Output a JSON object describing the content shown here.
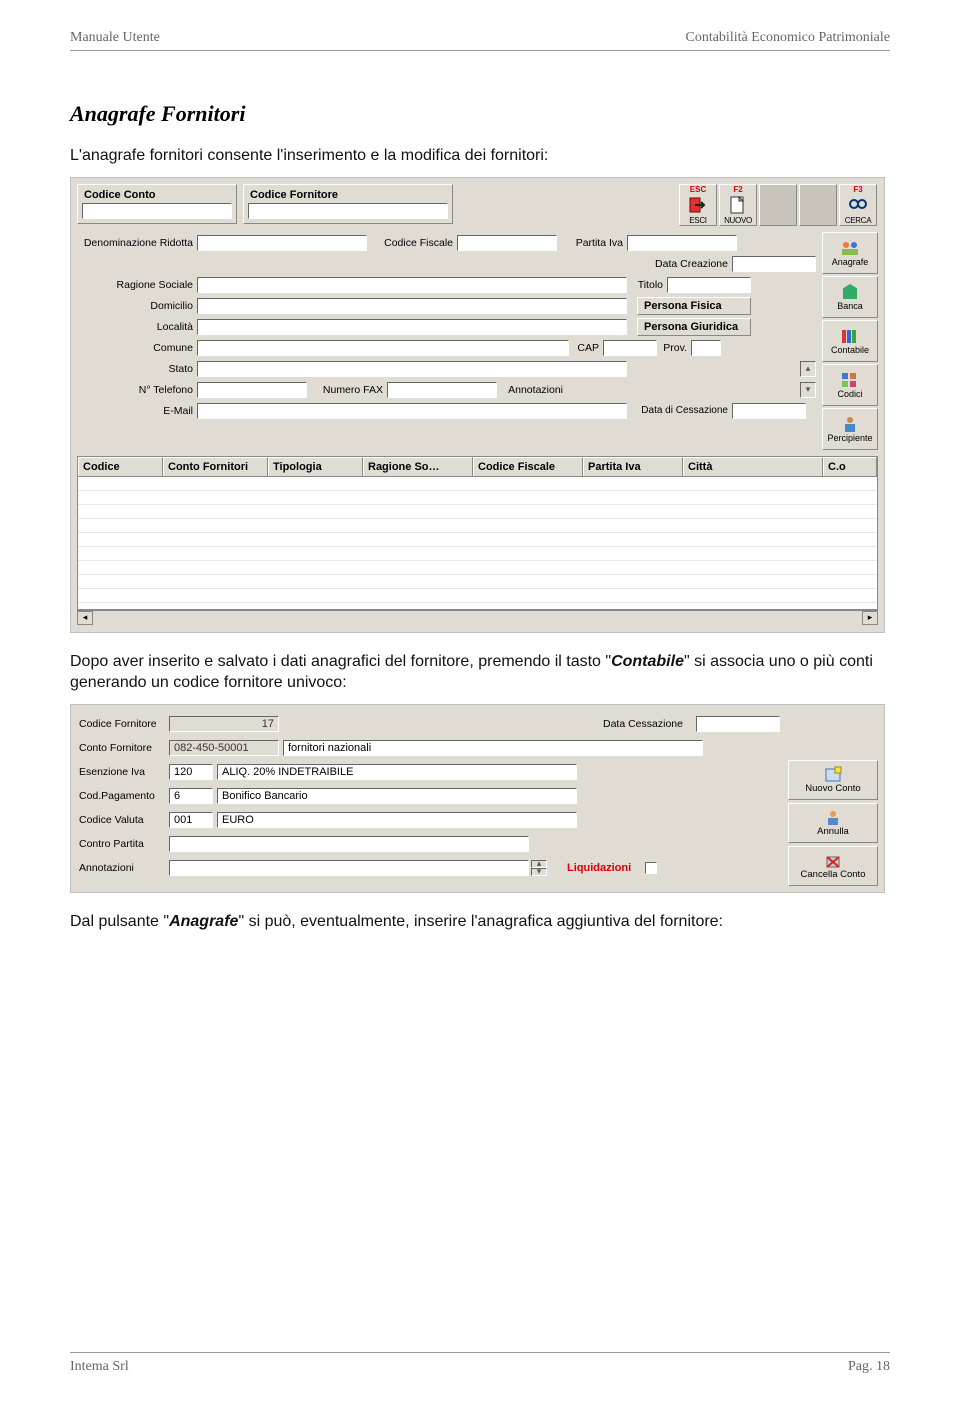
{
  "header": {
    "left": "Manuale Utente",
    "right": "Contabilità Economico Patrimoniale"
  },
  "section_title": "Anagrafe Fornitori",
  "intro": "L'anagrafe fornitori consente l'inserimento e la modifica dei fornitori:",
  "form1": {
    "codice_conto": "Codice Conto",
    "codice_fornitore": "Codice Fornitore",
    "tb_esc": "ESC",
    "tb_esci": "ESCI",
    "tb_f2": "F2",
    "tb_nuovo": "NUOVO",
    "tb_f3": "F3",
    "tb_cerca": "CERCA",
    "lbl_denom": "Denominazione Ridotta",
    "lbl_cf": "Codice Fiscale",
    "lbl_piva": "Partita Iva",
    "lbl_datacrea": "Data Creazione",
    "lbl_ragione": "Ragione Sociale",
    "lbl_titolo": "Titolo",
    "lbl_domicilio": "Domicilio",
    "btn_pf": "Persona Fisica",
    "lbl_localita": "Località",
    "btn_pg": "Persona Giuridica",
    "lbl_comune": "Comune",
    "lbl_cap": "CAP",
    "lbl_prov": "Prov.",
    "lbl_stato": "Stato",
    "lbl_tel": "N° Telefono",
    "lbl_fax": "Numero FAX",
    "lbl_anno": "Annotazioni",
    "lbl_email": "E-Mail",
    "lbl_datacess": "Data di Cessazione",
    "side": {
      "anagrafe": "Anagrafe",
      "banca": "Banca",
      "contabile": "Contabile",
      "codici": "Codici",
      "percipiente": "Percipiente"
    },
    "grid": {
      "c1": "Codice",
      "c2": "Conto Fornitori",
      "c3": "Tipologia",
      "c4": "Ragione So…",
      "c5": "Codice Fiscale",
      "c6": "Partita Iva",
      "c7": "Città",
      "c8": "C.o"
    }
  },
  "para2_a": "Dopo aver inserito e salvato i dati anagrafici del fornitore, premendo il tasto \"",
  "para2_b": "Contabile",
  "para2_c": "\" si associa uno o più conti generando un codice fornitore univoco:",
  "form2": {
    "lbl_codforn": "Codice Fornitore",
    "val_codforn": "17",
    "lbl_datacess": "Data Cessazione",
    "lbl_contof": "Conto Fornitore",
    "val_contof": "082-450-50001",
    "desc_contof": "fornitori nazionali",
    "lbl_esenz": "Esenzione Iva",
    "val_esenz": "120",
    "desc_esenz": "ALIQ. 20% INDETRAIBILE",
    "lbl_codpag": "Cod.Pagamento",
    "val_codpag": "6",
    "desc_codpag": "Bonifico Bancario",
    "lbl_codval": "Codice Valuta",
    "val_codval": "001",
    "desc_codval": "EURO",
    "lbl_contropart": "Contro Partita",
    "lbl_anno": "Annotazioni",
    "lbl_liq": "Liquidazioni",
    "btn_nuovo": "Nuovo Conto",
    "btn_annulla": "Annulla",
    "btn_cancella": "Cancella Conto"
  },
  "para3_a": "Dal pulsante \"",
  "para3_b": "Anagrafe",
  "para3_c": "\" si può, eventualmente, inserire l'anagrafica aggiuntiva del fornitore:",
  "footer": {
    "left": "Intema Srl",
    "right": "Pag.  18"
  }
}
